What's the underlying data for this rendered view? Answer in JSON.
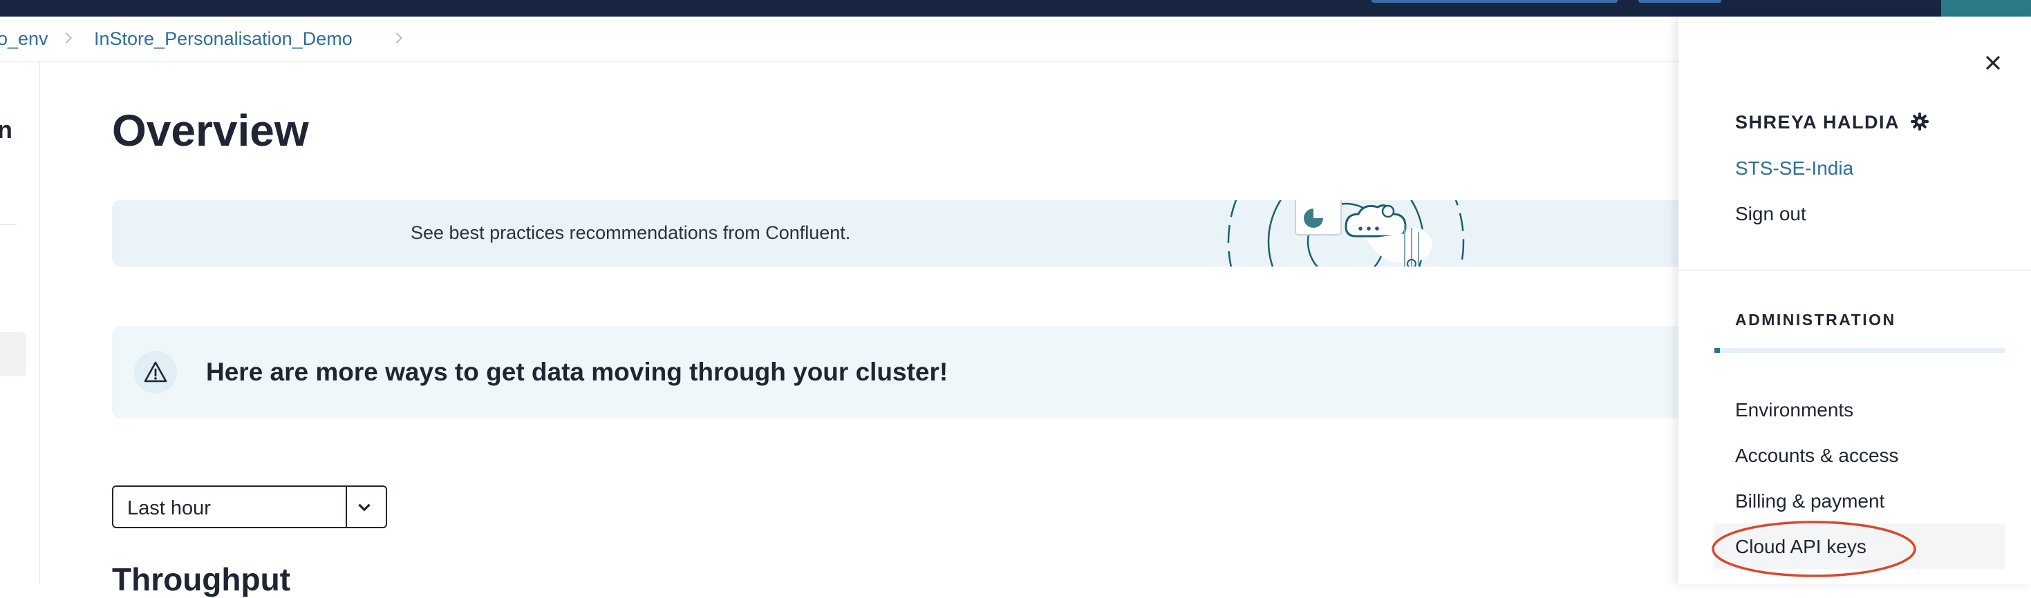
{
  "breadcrumb": {
    "items": [
      {
        "label": "o_env"
      },
      {
        "label": "InStore_Personalisation_Demo"
      }
    ]
  },
  "left_rail": {
    "cut_text": "n"
  },
  "main": {
    "title": "Overview",
    "promo_banner": {
      "text": "See best practices recommendations from Confluent."
    },
    "info_banner": {
      "text": "Here are more ways to get data moving through your cluster!"
    },
    "time_range": {
      "selected": "Last hour"
    },
    "section_heading": "Throughput"
  },
  "side_panel": {
    "user_name": "SHREYA HALDIA",
    "organization": "STS-SE-India",
    "sign_out": "Sign out",
    "admin_heading": "ADMINISTRATION",
    "admin_items": [
      {
        "label": "Environments"
      },
      {
        "label": "Accounts & access"
      },
      {
        "label": "Billing & payment"
      },
      {
        "label": "Cloud API keys"
      }
    ],
    "highlight_color": "#d9482b"
  },
  "colors": {
    "topbar": "#172541",
    "link": "#2f6e9a",
    "banner": "#e9f3f8",
    "accent_teal": "#2a7a87"
  },
  "icons": [
    "chevron-right-icon",
    "warning-icon",
    "chevron-down-icon",
    "close-icon",
    "gear-icon"
  ]
}
